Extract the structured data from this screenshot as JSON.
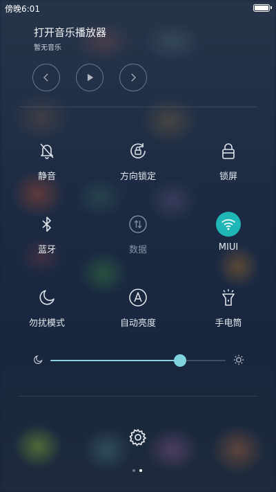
{
  "status_bar": {
    "time": "傍晚6:01"
  },
  "music": {
    "title": "打开音乐播放器",
    "subtitle": "暂无音乐"
  },
  "tiles": [
    {
      "label": "静音",
      "icon": "bell-mute-icon",
      "active": false
    },
    {
      "label": "方向锁定",
      "icon": "rotation-lock-icon",
      "active": false
    },
    {
      "label": "锁屏",
      "icon": "lock-icon",
      "active": false
    },
    {
      "label": "蓝牙",
      "icon": "bluetooth-icon",
      "active": false
    },
    {
      "label": "数据",
      "icon": "data-arrows-icon",
      "active": false,
      "disabled": true
    },
    {
      "label": "MIUI",
      "icon": "wifi-icon",
      "active": true
    },
    {
      "label": "勿扰模式",
      "icon": "moon-icon",
      "active": false
    },
    {
      "label": "自动亮度",
      "icon": "auto-brightness-icon",
      "active": false
    },
    {
      "label": "手电筒",
      "icon": "flashlight-icon",
      "active": false
    }
  ],
  "brightness": {
    "level": 0.74
  },
  "page_indicator": {
    "current": 2,
    "total": 2
  },
  "colors": {
    "accent": "#1fb7b5",
    "slider": "#7fd3df"
  }
}
